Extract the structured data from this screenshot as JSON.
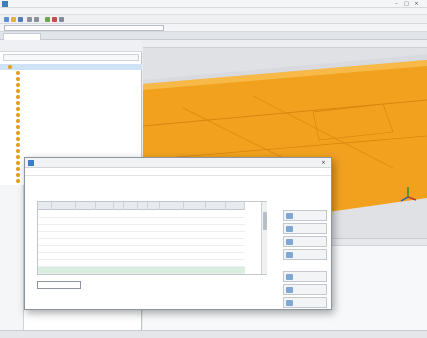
{
  "app": {
    "title": ""
  },
  "menu": {
    "items": [
      "",
      "",
      "",
      "",
      "",
      "",
      "",
      "",
      "",
      "",
      "",
      ""
    ]
  },
  "addressbar": {
    "value": ""
  },
  "tabs": [
    ""
  ],
  "left_panel": {
    "header": "",
    "tree": [
      "",
      "",
      "",
      "",
      "",
      "",
      "",
      "",
      "",
      "",
      "",
      "",
      "",
      "",
      "",
      "",
      "",
      "",
      "",
      "",
      "",
      "",
      "",
      "",
      "",
      "",
      "",
      "",
      "",
      "",
      "",
      "",
      "",
      "",
      "",
      "",
      "",
      "",
      "",
      "",
      "",
      "",
      "",
      "",
      ""
    ]
  },
  "properties": {
    "lines": [
      "",
      "",
      "",
      "",
      "",
      "",
      "",
      "",
      "",
      "",
      "",
      "",
      ""
    ]
  },
  "viewport": {
    "status": ""
  },
  "bottom_panel": {
    "text": ""
  },
  "statusbar": {
    "text": ""
  },
  "dialog": {
    "title": "",
    "menu": [
      "",
      "",
      "",
      ""
    ],
    "header": "",
    "table": {
      "columns": [
        "",
        "",
        "",
        "",
        "",
        "",
        "",
        "",
        "",
        "",
        "",
        ""
      ],
      "rows": [
        [
          "",
          "",
          "",
          "",
          "",
          "",
          "",
          "",
          "",
          "",
          "",
          ""
        ],
        [
          "",
          "",
          "",
          "",
          "",
          "",
          "",
          "",
          "",
          "",
          "",
          ""
        ],
        [
          "",
          "",
          "",
          "",
          "",
          "",
          "",
          "",
          "",
          "",
          "",
          ""
        ],
        [
          "",
          "",
          "",
          "",
          "",
          "",
          "",
          "",
          "",
          "",
          "",
          ""
        ],
        [
          "",
          "",
          "",
          "",
          "",
          "",
          "",
          "",
          "",
          "",
          "",
          ""
        ],
        [
          "",
          "",
          "",
          "",
          "",
          "",
          "",
          "",
          "",
          "",
          "",
          ""
        ],
        [
          "",
          "",
          "",
          "",
          "",
          "",
          "",
          "",
          "",
          "",
          "",
          ""
        ],
        [
          "",
          "",
          "",
          "",
          "",
          "",
          "",
          "",
          "",
          "",
          "",
          ""
        ],
        [
          "",
          "",
          "",
          "",
          "",
          "",
          "",
          "",
          "",
          "",
          "",
          ""
        ]
      ],
      "highlight_row": 8
    },
    "footer_label": "",
    "buttons": [
      "",
      "",
      "",
      "",
      "",
      "",
      "",
      "",
      "",
      "",
      "",
      "",
      "",
      "",
      ""
    ]
  },
  "icons": {
    "app": "cube-app-icon",
    "axes": "xyz-axes-icon",
    "close": "close-icon"
  },
  "colors": {
    "model": "#f2a11f",
    "model_dark": "#d8860d",
    "selection": "#cfe3f7",
    "highlight_row": "#d8efe0",
    "accent": "#3d7fc1"
  }
}
